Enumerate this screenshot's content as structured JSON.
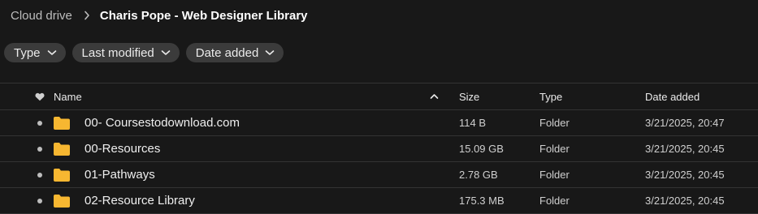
{
  "breadcrumb": {
    "root": "Cloud drive",
    "current": "Charis Pope - Web Designer Library"
  },
  "filters": [
    {
      "label": "Type"
    },
    {
      "label": "Last modified"
    },
    {
      "label": "Date added"
    }
  ],
  "table": {
    "columns": {
      "name": "Name",
      "size": "Size",
      "type": "Type",
      "date_added": "Date added"
    },
    "rows": [
      {
        "name": "00- Coursestodownload.com",
        "size": "114 B",
        "type": "Folder",
        "date_added": "3/21/2025, 20:47"
      },
      {
        "name": "00-Resources",
        "size": "15.09 GB",
        "type": "Folder",
        "date_added": "3/21/2025, 20:45"
      },
      {
        "name": "01-Pathways",
        "size": "2.78 GB",
        "type": "Folder",
        "date_added": "3/21/2025, 20:45"
      },
      {
        "name": "02-Resource Library",
        "size": "175.3 MB",
        "type": "Folder",
        "date_added": "3/21/2025, 20:45"
      }
    ]
  },
  "colors": {
    "background": "#181818",
    "chip": "#3b3b3b",
    "folder": "#f7b731",
    "divider": "#333333"
  }
}
